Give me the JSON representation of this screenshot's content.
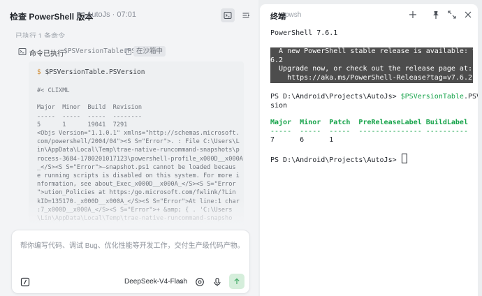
{
  "left_header": {
    "title": "检查 PowerShell 版本",
    "project": "AutoJs · 07:01"
  },
  "task": {
    "progress_text": "已执行 1 条命令",
    "cmd_label": "命令已执行",
    "cmd_name": "$PSVersionTable.PS...",
    "sandbox_badge": "在沙箱中"
  },
  "code_block": {
    "prompt_symbol": "$",
    "command": "$PSVersionTable.PSVersion",
    "output_lines": [
      "#< CLIXML",
      "",
      "Major  Minor  Build  Revision",
      "-----  -----  -----  --------",
      "5      1      19041  7291",
      "<Objs Version=\"1.1.0.1\" xmlns=\"http://schemas.microsoft.",
      "com/powershell/2004/04\"><S S=\"Error\">. : File C:\\Users\\L",
      "in\\AppData\\Local\\Temp\\trae-native-runcommand-snapshots\\p",
      "rocess-3684-1780201017123\\powershell-profile_x000D__x000A",
      "_</S><S S=\"Error\">—snapshot.ps1 cannot be loaded becaus",
      "e running scripts is disabled on this system. For more i",
      "nformation, see about_Exec_x000D__x000A_</S><S S=\"Error",
      "\">ution_Policies at https:/go.microsoft.com/fwlink/?Lin",
      "kID=135170._x000D__x000A_</S><S S=\"Error\">At line:1 char",
      ":7_x000D__x000A_</S><S S=\"Error\">+ &amp; { . 'C:\\Users",
      "\\Lin\\AppData\\Local\\Temp\\trae-native-runcommand-snapsho"
    ]
  },
  "input": {
    "placeholder": "帮你编写代码、调试 Bug、优化性能等开发工作，交付生产级代码产物。",
    "model": "DeepSeek-V4-Flash"
  },
  "terminal": {
    "title": "终端",
    "shell": "pwsh",
    "version_line": "PowerShell 7.6.1",
    "notice_lines": [
      "  A new PowerShell stable release is available: v7.",
      "6.2",
      "  Upgrade now, or check out the release page at:",
      "    https://aka.ms/PowerShell-Release?tag=v7.6.2"
    ],
    "prompt": "PS D:\\Android\\Projects\\AutoJs> ",
    "command_var": "$PSVersionTable",
    "command_rest": ".PSVer",
    "command_wrap": "sion",
    "table_header": "Major  Minor  Patch  PreReleaseLabel BuildLabel",
    "table_divider": "-----  -----  -----  --------------- ----------",
    "table_row": "7      6      1",
    "final_prompt": "PS D:\\Android\\Projects\\AutoJs> "
  },
  "icons": {
    "folder": "folder-icon",
    "terminal_toggle": "terminal-icon",
    "list_toggle": "list-icon",
    "cmd": "terminal-square-icon",
    "copy": "copy-icon",
    "attach": "slash-command-icon",
    "mention": "mention-icon",
    "mic": "microphone-icon",
    "send": "arrow-up-icon",
    "add": "plus-icon",
    "pin": "pin-icon",
    "expand": "expand-icon",
    "close": "close-icon"
  },
  "colors": {
    "accent_green": "#16a34a",
    "notice_bg": "#4d4d4d",
    "send_bg": "#d5eedb"
  }
}
